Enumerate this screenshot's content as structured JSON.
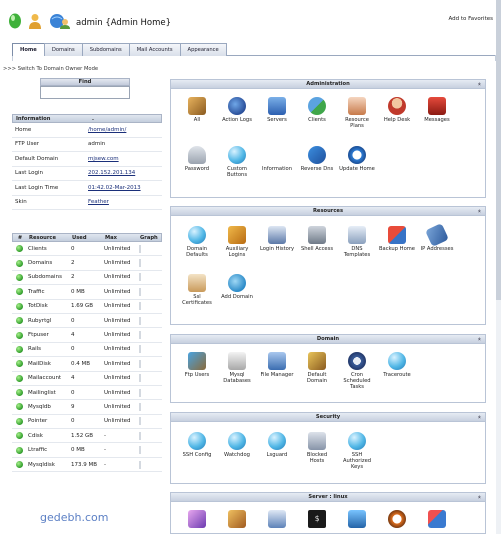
{
  "header": {
    "title": "admin {Admin Home}",
    "add_favorites": "Add to Favorites",
    "icons": [
      "traffic-light-icon",
      "user-icon",
      "globe-users-icon"
    ]
  },
  "tabs": [
    {
      "label": "Home",
      "active": true
    },
    {
      "label": "Domains"
    },
    {
      "label": "Subdomains"
    },
    {
      "label": "Mail Accounts"
    },
    {
      "label": "Appearance"
    }
  ],
  "switch_mode": ">>> Switch To Domain Owner Mode",
  "find": {
    "label": "Find",
    "value": ""
  },
  "information": {
    "header": "Information",
    "rows": [
      {
        "key": "Home",
        "value": "/home/admin/",
        "link": true
      },
      {
        "key": "FTP User",
        "value": "admin",
        "link": false
      },
      {
        "key": "Default Domain",
        "value": "mjsew.com",
        "link": true
      },
      {
        "key": "Last Login",
        "value": "202.152.201.134",
        "link": true
      },
      {
        "key": "Last Login Time",
        "value": "01:42.02-Mar-2013",
        "link": true
      },
      {
        "key": "Skin",
        "value": "Feather",
        "link": true
      }
    ]
  },
  "resources_table": {
    "headers": [
      "#",
      "Resource",
      "Used",
      "Max",
      "Graph"
    ],
    "rows": [
      {
        "name": "Clients",
        "used": "0",
        "max": "Unlimited"
      },
      {
        "name": "Domains",
        "used": "2",
        "max": "Unlimited"
      },
      {
        "name": "Subdomains",
        "used": "2",
        "max": "Unlimited"
      },
      {
        "name": "Traffic",
        "used": "0 MB",
        "max": "Unlimited"
      },
      {
        "name": "TotDisk",
        "used": "1.69 GB",
        "max": "Unlimited"
      },
      {
        "name": "Rubyrtgl",
        "used": "0",
        "max": "Unlimited"
      },
      {
        "name": "Ftpuser",
        "used": "4",
        "max": "Unlimited"
      },
      {
        "name": "Rails",
        "used": "0",
        "max": "Unlimited"
      },
      {
        "name": "MailDisk",
        "used": "0.4 MB",
        "max": "Unlimited"
      },
      {
        "name": "Mailaccount",
        "used": "4",
        "max": "Unlimited"
      },
      {
        "name": "Mailinglist",
        "used": "0",
        "max": "Unlimited"
      },
      {
        "name": "Mysqldb",
        "used": "9",
        "max": "Unlimited"
      },
      {
        "name": "Pointer",
        "used": "0",
        "max": "Unlimited"
      },
      {
        "name": "Cdisk",
        "used": "1.52 GB",
        "max": "-"
      },
      {
        "name": "Ltraffic",
        "used": "0 MB",
        "max": "-"
      },
      {
        "name": "Mysqldisk",
        "used": "173.9 MB",
        "max": "-"
      }
    ]
  },
  "panels": {
    "administration": {
      "title": "Administration",
      "items": [
        {
          "label": "All",
          "icon": "all"
        },
        {
          "label": "Action Logs",
          "icon": "logs"
        },
        {
          "label": "Servers",
          "icon": "servers"
        },
        {
          "label": "Clients",
          "icon": "clients"
        },
        {
          "label": "Resource Plans",
          "icon": "plans"
        },
        {
          "label": "Help Desk",
          "icon": "help"
        },
        {
          "label": "Messages",
          "icon": "msg"
        },
        {
          "label": "Password",
          "icon": "pwd"
        },
        {
          "label": "Custom Buttons",
          "icon": "ball"
        },
        {
          "label": "Information",
          "icon": "info"
        },
        {
          "label": "Reverse Dns",
          "icon": "rdns"
        },
        {
          "label": "Update Home",
          "icon": "upd"
        }
      ]
    },
    "resources": {
      "title": "Resources",
      "items": [
        {
          "label": "Domain Defaults",
          "icon": "ball"
        },
        {
          "label": "Auxiliary Logins",
          "icon": "aux"
        },
        {
          "label": "Login History",
          "icon": "lhist"
        },
        {
          "label": "Shell Access",
          "icon": "shell"
        },
        {
          "label": "DNS Templates",
          "icon": "dnst"
        },
        {
          "label": "Backup Home",
          "icon": "backup"
        },
        {
          "label": "IP Addresses",
          "icon": "ip"
        },
        {
          "label": "Ssl Certificates",
          "icon": "ssl"
        },
        {
          "label": "Add Domain",
          "icon": "adddom"
        }
      ]
    },
    "domain": {
      "title": "Domain",
      "items": [
        {
          "label": "Ftp Users",
          "icon": "ftp"
        },
        {
          "label": "Mysql Databases",
          "icon": "mysql"
        },
        {
          "label": "File Manager",
          "icon": "fm"
        },
        {
          "label": "Default Domain",
          "icon": "defdom"
        },
        {
          "label": "Cron Scheduled Tasks",
          "icon": "cron"
        },
        {
          "label": "Traceroute",
          "icon": "ball"
        }
      ]
    },
    "security": {
      "title": "Security",
      "items": [
        {
          "label": "SSH Config",
          "icon": "ball"
        },
        {
          "label": "Watchdog",
          "icon": "ball"
        },
        {
          "label": "Lsguard",
          "icon": "ball"
        },
        {
          "label": "Blocked Hosts",
          "icon": "blocked"
        },
        {
          "label": "SSH Authorized Keys",
          "icon": "ball"
        }
      ]
    },
    "server_linux": {
      "title": "Server : linux",
      "items": [
        {
          "label": "",
          "icon": "srv1"
        },
        {
          "label": "",
          "icon": "srv2"
        },
        {
          "label": "",
          "icon": "srv3"
        },
        {
          "label": "",
          "icon": "srv4",
          "glyph": "$"
        },
        {
          "label": "",
          "icon": "srv5"
        },
        {
          "label": "",
          "icon": "srv6"
        },
        {
          "label": "",
          "icon": "srv7"
        }
      ]
    }
  },
  "watermark": "gedebh.com"
}
